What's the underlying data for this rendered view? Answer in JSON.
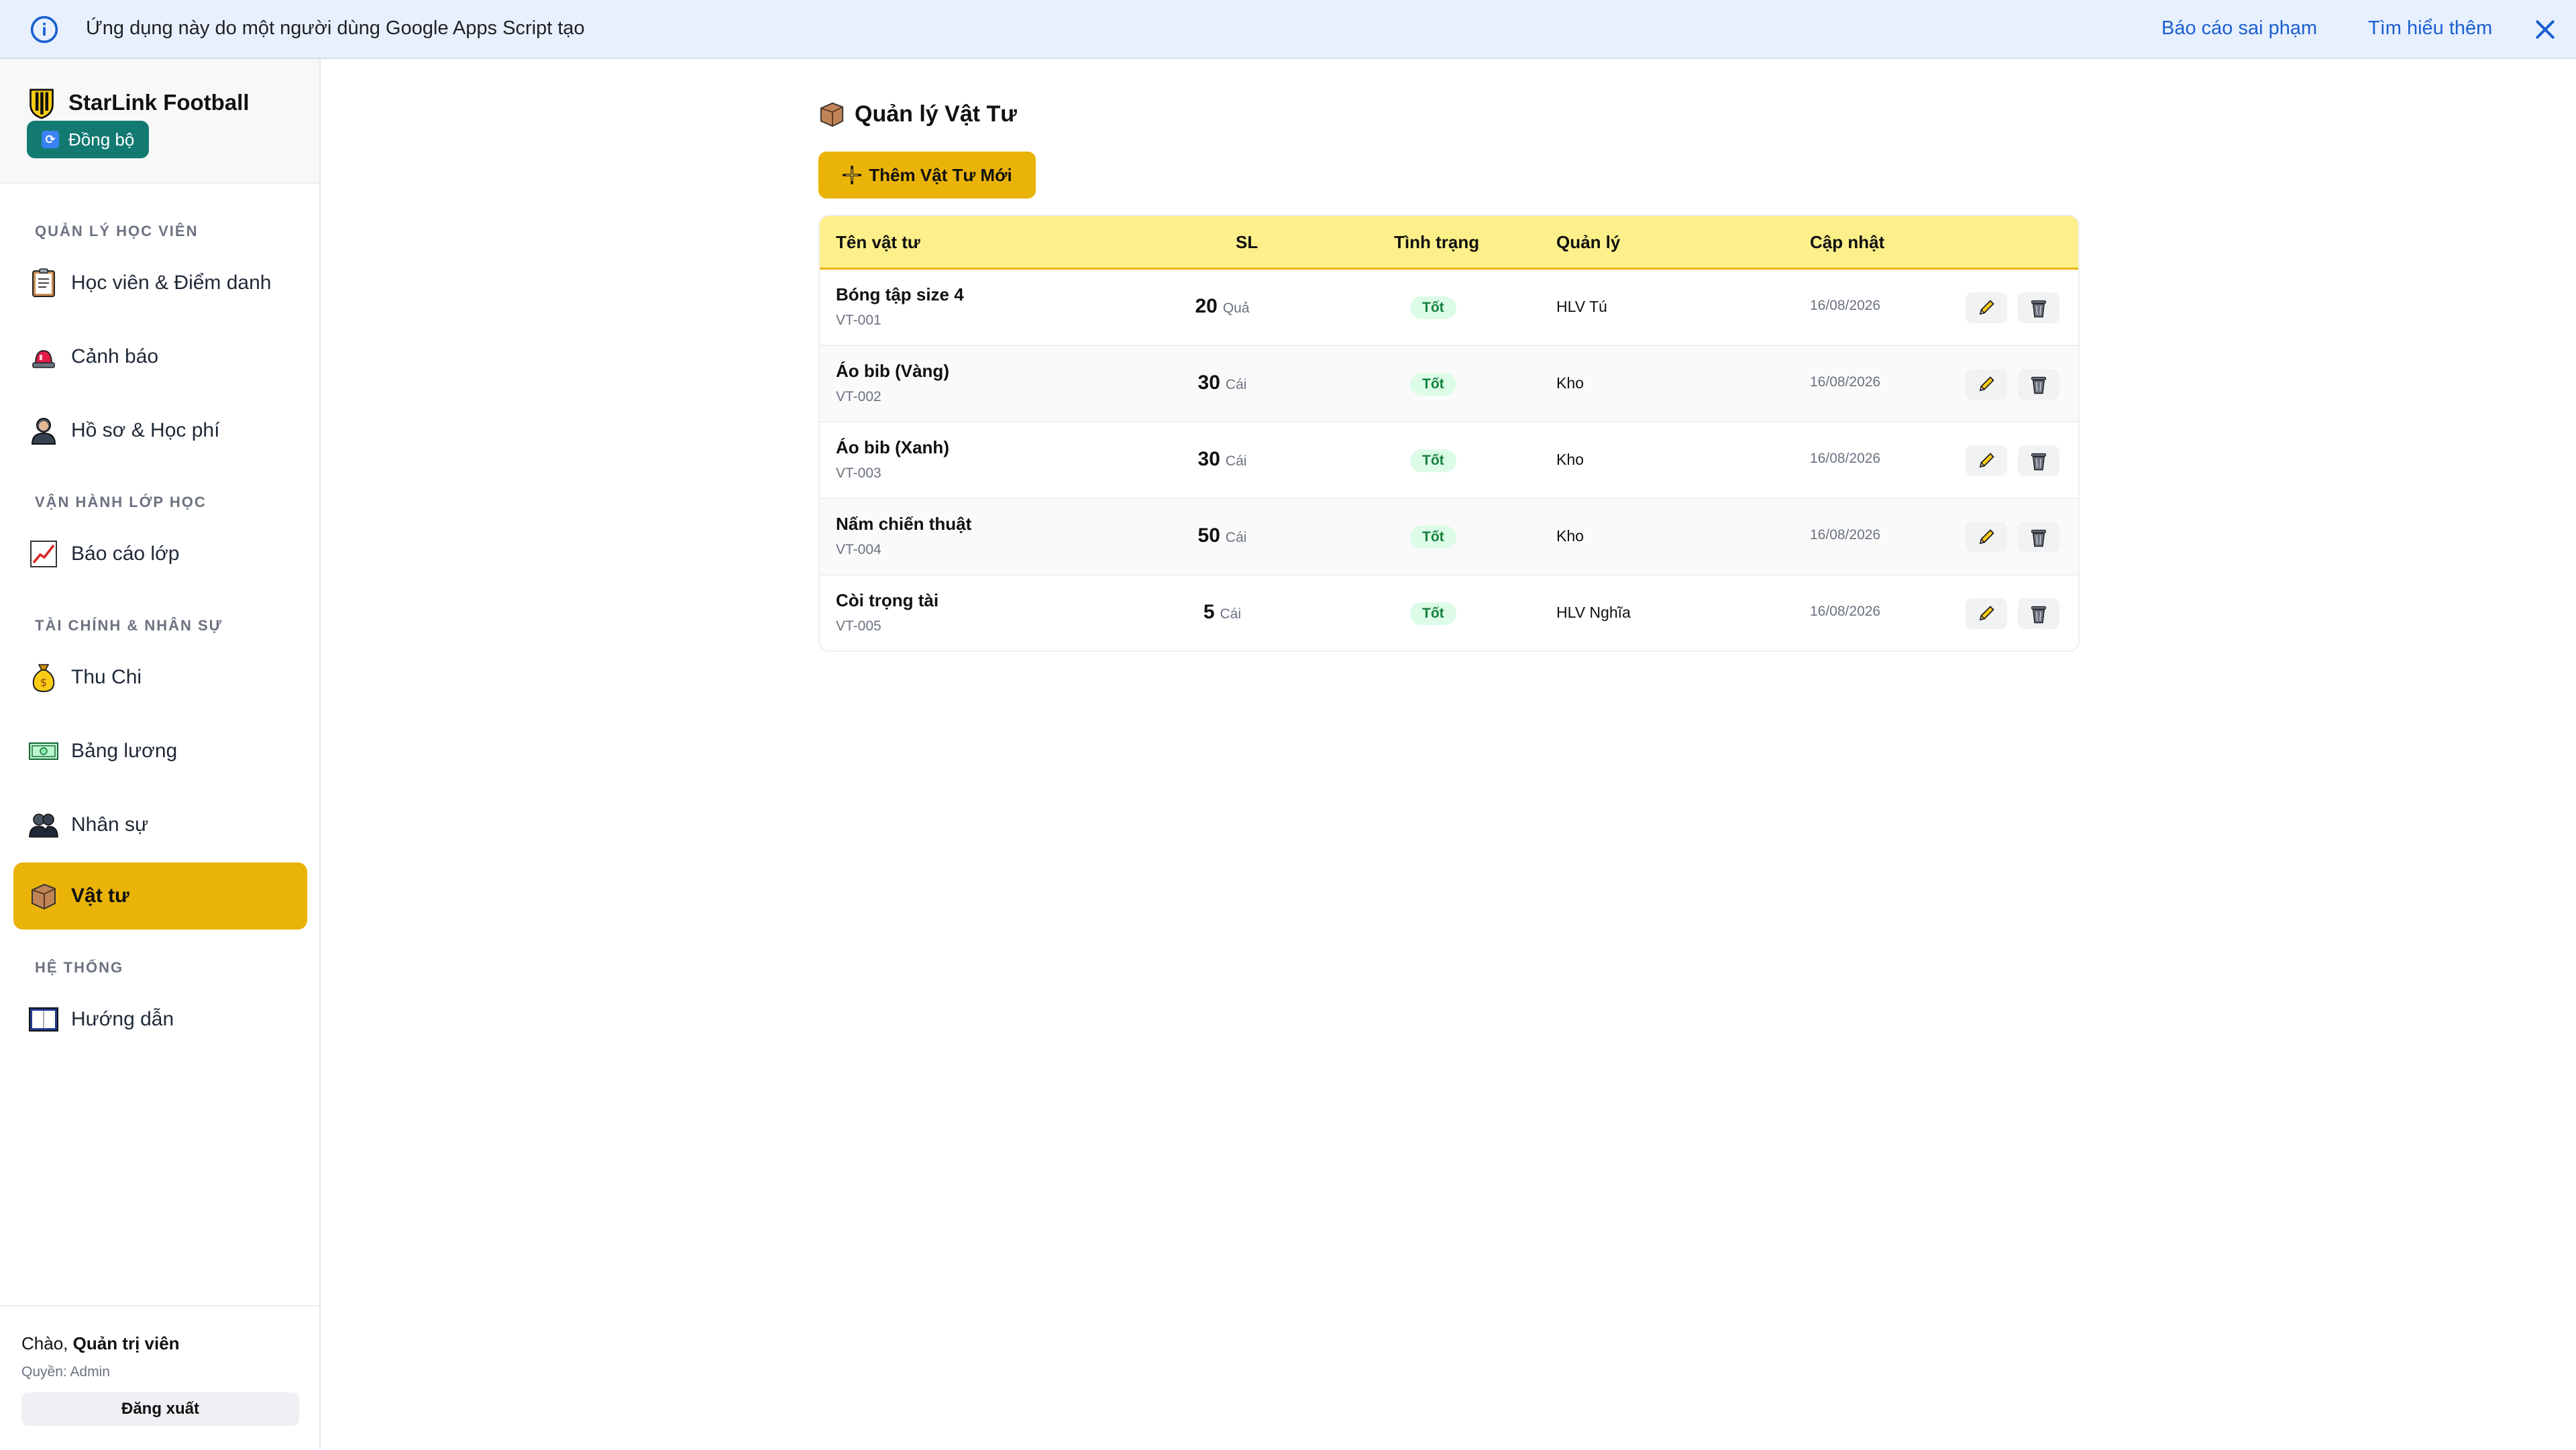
{
  "banner": {
    "text": "Ứng dụng này do một người dùng Google Apps Script tạo",
    "report_link": "Báo cáo sai phạm",
    "learn_link": "Tìm hiểu thêm"
  },
  "sidebar": {
    "brand": "StarLink Football",
    "sync_label": "Đồng bộ",
    "sections": [
      {
        "title": "QUẢN LÝ HỌC VIÊN",
        "items": [
          {
            "label": "Học viên & Điểm danh",
            "icon": "clipboard-icon"
          },
          {
            "label": "Cảnh báo",
            "icon": "siren-icon"
          },
          {
            "label": "Hồ sơ & Học phí",
            "icon": "person-icon"
          }
        ]
      },
      {
        "title": "VẬN HÀNH LỚP HỌC",
        "items": [
          {
            "label": "Báo cáo lớp",
            "icon": "chart-up-icon"
          }
        ]
      },
      {
        "title": "TÀI CHÍNH & NHÂN SỰ",
        "items": [
          {
            "label": "Thu Chi",
            "icon": "money-bag-icon"
          },
          {
            "label": "Bảng lương",
            "icon": "banknote-icon"
          },
          {
            "label": "Nhân sự",
            "icon": "people-icon"
          },
          {
            "label": "Vật tư",
            "icon": "package-icon",
            "active": true
          }
        ]
      },
      {
        "title": "HỆ THỐNG",
        "items": [
          {
            "label": "Hướng dẫn",
            "icon": "book-icon"
          }
        ]
      }
    ],
    "user": {
      "greeting_prefix": "Chào,",
      "name": "Quản trị viên",
      "role": "Quyền: Admin",
      "logout_label": "Đăng xuất"
    }
  },
  "main": {
    "title": "Quản lý Vật Tư",
    "add_button": "Thêm Vật Tư Mới",
    "table": {
      "headers": [
        "Tên vật tư",
        "SL",
        "Tình trạng",
        "Quản lý",
        "Cập nhật"
      ],
      "rows": [
        {
          "name": "Bóng tập size 4",
          "code": "VT-001",
          "qty": "20",
          "unit": "Quả",
          "status": "Tốt",
          "manager": "HLV Tú",
          "date": "16/08/2026"
        },
        {
          "name": "Áo bib (Vàng)",
          "code": "VT-002",
          "qty": "30",
          "unit": "Cái",
          "status": "Tốt",
          "manager": "Kho",
          "date": "16/08/2026"
        },
        {
          "name": "Áo bib (Xanh)",
          "code": "VT-003",
          "qty": "30",
          "unit": "Cái",
          "status": "Tốt",
          "manager": "Kho",
          "date": "16/08/2026"
        },
        {
          "name": "Nấm chiến thuật",
          "code": "VT-004",
          "qty": "50",
          "unit": "Cái",
          "status": "Tốt",
          "manager": "Kho",
          "date": "16/08/2026"
        },
        {
          "name": "Còi trọng tài",
          "code": "VT-005",
          "qty": "5",
          "unit": "Cái",
          "status": "Tốt",
          "manager": "HLV Nghĩa",
          "date": "16/08/2026"
        }
      ]
    }
  },
  "colors": {
    "accent": "#eab308",
    "header_bg": "#fdf08a",
    "sync_bg": "#137a72",
    "status_bg": "#dcfce7",
    "status_text": "#15803d",
    "link": "#1a5fd0"
  }
}
